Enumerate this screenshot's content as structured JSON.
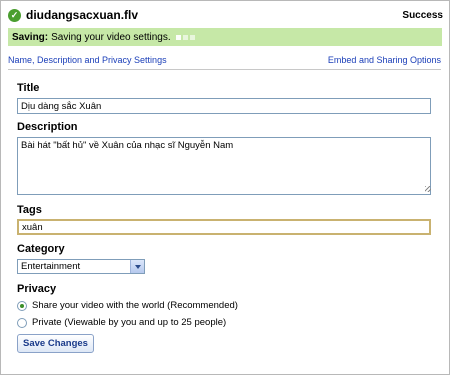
{
  "header": {
    "filename": "diudangsacxuan.flv",
    "status": "Success",
    "status_icon": "check-circle-icon",
    "status_color": "#4a9e2f"
  },
  "status_bar": {
    "label": "Saving:",
    "message": "Saving your video settings.",
    "background": "#c6e8a7"
  },
  "nav": {
    "left_link": "Name, Description and Privacy Settings",
    "right_link": "Embed and Sharing Options",
    "link_color": "#1a3eb8"
  },
  "form": {
    "title_label": "Title",
    "title_value": "Dịu dàng sắc Xuân",
    "description_label": "Description",
    "description_value": "Bài hát \"bất hủ\" về Xuân của nhạc sĩ Nguyễn Nam",
    "tags_label": "Tags",
    "tags_value": "xuân",
    "category_label": "Category",
    "category_selected": "Entertainment",
    "privacy_label": "Privacy",
    "privacy_options": [
      {
        "label": "Share your video with the world (Recommended)",
        "checked": true
      },
      {
        "label": "Private (Viewable by you and up to 25 people)",
        "checked": false
      }
    ],
    "save_label": "Save Changes"
  }
}
